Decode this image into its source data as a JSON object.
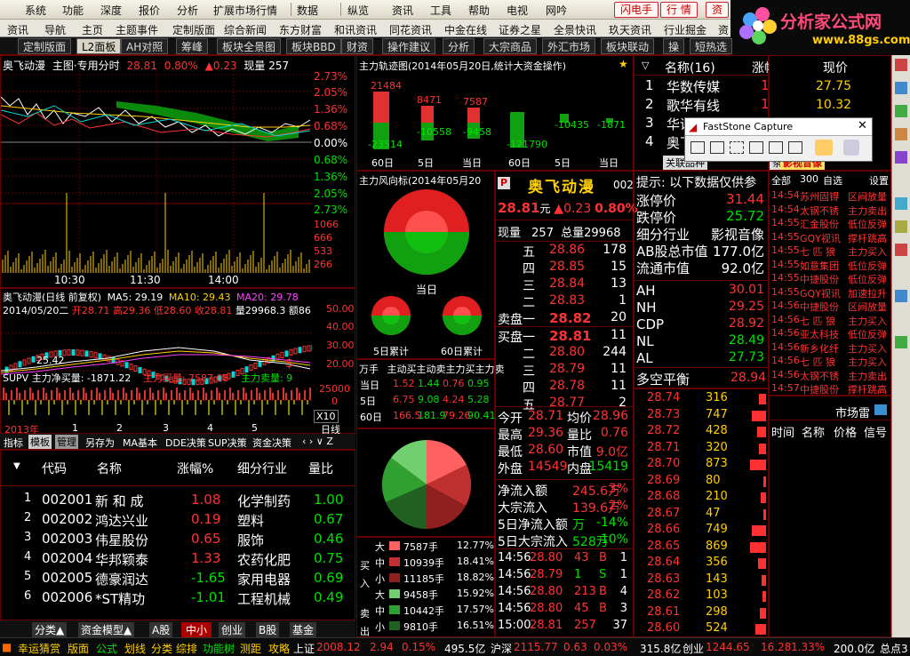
{
  "menu": [
    "系统",
    "功能",
    "深度",
    "报价",
    "分析",
    "扩展市场行情",
    "数据",
    "纵览",
    "资讯",
    "工具",
    "帮助",
    "电视",
    "网吟"
  ],
  "menu_buttons": [
    "闪电手",
    "行 情",
    "资"
  ],
  "logo": {
    "title": "分析家公式网",
    "url": "www.88gs.com"
  },
  "tabs2": [
    "资讯",
    "导航",
    "主页",
    "主题事件",
    "定制版面",
    "综合新闻",
    "东方财富",
    "和讯资讯",
    "同花资讯",
    "中金在线",
    "证券之星",
    "全景快讯",
    "玖天资讯",
    "行业掘金",
    "资"
  ],
  "tabs3": [
    "定制版面",
    "L2面板",
    "AH对照",
    "筹峰",
    "板块全景图",
    "板块BBD",
    "财资",
    "操作建议",
    "分析",
    "大宗商品",
    "外汇市场",
    "板块联动",
    "操",
    "短热选"
  ],
  "intraday": {
    "header_name": "奥飞动漫",
    "header_mode": "主图·专用分时",
    "price": "28.81",
    "pct": "0.80%",
    "chg": "▲0.23",
    "vol_label": "现量 257",
    "right_axis": [
      "2.73%",
      "2.05%",
      "1.36%",
      "0.68%",
      "0.00%",
      "0.68%",
      "1.36%",
      "2.05%",
      "2.73%"
    ],
    "vol_axis": [
      "1066",
      "933",
      "800",
      "666",
      "533",
      "400",
      "266",
      "133"
    ],
    "times": [
      "10:30",
      "11:30",
      "14:00"
    ]
  },
  "kline": {
    "title": "奥飞动漫(日线 前复权)",
    "ma5": "MA5: 29.19",
    "ma10": "MA10: 29.43",
    "ma20": "MA20: 29.78",
    "info_date": "2014/05/20二",
    "info_open": "开28.71",
    "info_high": "高29.36",
    "info_low": "低28.60",
    "info_close": "收28.81",
    "info_vol": "量29968.3",
    "info_amt": "额86",
    "axis": [
      "50.00",
      "40.00",
      "30.00",
      "20.00"
    ],
    "low_mark": "25.42",
    "supv": "SUPV 主力净买量: -1871.22",
    "supv_buy": "主力买量: 7587.08",
    "supv_sell": "主力卖量: 9",
    "supv_axis": [
      "25000",
      "0"
    ],
    "x10": "X10",
    "years": [
      "2013年",
      "1",
      "2",
      "3",
      "4",
      "5"
    ],
    "period": "日线"
  },
  "indicator_tabs": [
    "指标",
    "模板",
    "管理",
    "另存为",
    "MA基本",
    "DDE决策",
    "SUP决策",
    "资金决策"
  ],
  "stock_list": {
    "headers": [
      "代码",
      "名称",
      "涨幅%",
      "细分行业",
      "量比"
    ],
    "rows": [
      {
        "idx": "1",
        "code": "002001",
        "name": "新 和 成",
        "pct": "1.08",
        "ind": "化学制药",
        "ratio": "1.00"
      },
      {
        "idx": "2",
        "code": "002002",
        "name": "鸿达兴业",
        "pct": "0.19",
        "ind": "塑料",
        "ratio": "0.67"
      },
      {
        "idx": "3",
        "code": "002003",
        "name": "伟星股份",
        "pct": "0.65",
        "ind": "服饰",
        "ratio": "0.46"
      },
      {
        "idx": "4",
        "code": "002004",
        "name": "华邦颖泰",
        "pct": "1.33",
        "ind": "农药化肥",
        "ratio": "0.75"
      },
      {
        "idx": "5",
        "code": "002005",
        "name": "德豪润达",
        "pct": "-1.65",
        "ind": "家用电器",
        "ratio": "0.69"
      },
      {
        "idx": "6",
        "code": "002006",
        "name": "*ST精功",
        "pct": "-1.01",
        "ind": "工程机械",
        "ratio": "0.49"
      }
    ]
  },
  "bottom_tabs": [
    "分类▲",
    "资金模型▲",
    "A股",
    "中小",
    "创业",
    "B股",
    "基金"
  ],
  "track": {
    "title": "主力轨迹图(2014年05月20日,统计大资金操作)",
    "top_vals": [
      "21484",
      "8471",
      "7587"
    ],
    "bot_vals": [
      "-23514",
      "-10558",
      "-9458"
    ],
    "top_vals2": [
      "-10435",
      "-1871"
    ],
    "bot_vals2": [
      "-121790"
    ],
    "labels": [
      "60日",
      "5日",
      "当日",
      "60日",
      "5日",
      "当日"
    ]
  },
  "wind": {
    "title": "主力风向标(2014年05月20",
    "today": "当日",
    "d5": "5日累计",
    "d60": "60日累计"
  },
  "flow_table": {
    "headers": [
      "万手",
      "主动买",
      "主动卖",
      "主力买",
      "主力卖"
    ],
    "rows": [
      {
        "label": "当日",
        "v": [
          "1.52",
          "1.44",
          "0.76",
          "0.95"
        ]
      },
      {
        "label": "5日",
        "v": [
          "6.75",
          "9.08",
          "4.24",
          "5.28"
        ]
      },
      {
        "label": "60日",
        "v": [
          "166.5",
          "181.9",
          "79.26",
          "90.41"
        ]
      }
    ]
  },
  "pie_legend": {
    "buy": [
      {
        "l": "大",
        "v": "7587手",
        "p": "12.77%"
      },
      {
        "l": "中",
        "v": "10939手",
        "p": "18.41%"
      },
      {
        "l": "小",
        "v": "11185手",
        "p": "18.82%"
      }
    ],
    "sell": [
      {
        "l": "大",
        "v": "9458手",
        "p": "15.92%"
      },
      {
        "l": "中",
        "v": "10442手",
        "p": "17.57%"
      },
      {
        "l": "小",
        "v": "9810手",
        "p": "16.51%"
      }
    ],
    "buy_side": "买入",
    "sell_side": "卖出"
  },
  "quote": {
    "p_badge": "P",
    "name": "奥飞动漫",
    "code_part": "002",
    "price": "28.81",
    "unit": "元",
    "chg": "▲0.23",
    "pct": "0.80%",
    "cur_label": "现量",
    "cur_vol": "257",
    "total_label": "总量",
    "total_vol": "29968",
    "sells": [
      {
        "l": "五",
        "p": "28.86",
        "v": "178"
      },
      {
        "l": "四",
        "p": "28.85",
        "v": "15"
      },
      {
        "l": "三",
        "p": "28.84",
        "v": "13"
      },
      {
        "l": "二",
        "p": "28.83",
        "v": "1"
      },
      {
        "l": "卖盘一",
        "p": "28.82",
        "v": "20"
      }
    ],
    "buys": [
      {
        "l": "买盘一",
        "p": "28.81",
        "v": "11"
      },
      {
        "l": "二",
        "p": "28.80",
        "v": "244"
      },
      {
        "l": "三",
        "p": "28.79",
        "v": "11"
      },
      {
        "l": "四",
        "p": "28.78",
        "v": "11"
      },
      {
        "l": "五",
        "p": "28.77",
        "v": "2"
      }
    ],
    "stats": [
      {
        "l1": "今开",
        "v1": "28.71",
        "l2": "均价",
        "v2": "28.96"
      },
      {
        "l1": "最高",
        "v1": "29.36",
        "l2": "量比",
        "v2": "0.76"
      },
      {
        "l1": "最低",
        "v1": "28.60",
        "l2": "市值",
        "v2": "9.0亿"
      },
      {
        "l1": "外盘",
        "v1": "14549",
        "l2": "内盘",
        "v2": "15419"
      }
    ],
    "flows": [
      {
        "l": "净流入额",
        "v": "245.6万",
        "p": "3%"
      },
      {
        "l": "大宗流入",
        "v": "139.6万",
        "p": "2%"
      },
      {
        "l": "5日净流入额",
        "v": "万",
        "p": "-14%"
      },
      {
        "l": "5日大宗流入",
        "v": "528万",
        "p": "-10%"
      }
    ],
    "ticks": [
      {
        "t": "14:56",
        "p": "28.80",
        "v": "43",
        "f": "B",
        "n": "1"
      },
      {
        "t": "14:56",
        "p": "28.79",
        "v": "1",
        "f": "S",
        "n": "1"
      },
      {
        "t": "14:56",
        "p": "28.80",
        "v": "213",
        "f": "B",
        "n": "4"
      },
      {
        "t": "14:56",
        "p": "28.80",
        "v": "45",
        "f": "B",
        "n": "3"
      },
      {
        "t": "15:00",
        "p": "28.81",
        "v": "257",
        "f": "",
        "n": "37"
      }
    ]
  },
  "rank": {
    "headers": [
      "名称(16)",
      "涨幅%",
      "现价"
    ],
    "rows": [
      {
        "i": "1",
        "n": "华数传媒",
        "p": "1.83",
        "v": "27.75"
      },
      {
        "i": "2",
        "n": "歌华有线",
        "p": "1.57",
        "v": "10.32"
      },
      {
        "i": "3",
        "n": "华谊兄弟",
        "p": "",
        "v": ""
      },
      {
        "i": "4",
        "n": "奥飞动漫",
        "p": "",
        "v": ""
      }
    ],
    "subtabs": [
      "关联品种",
      "条板块",
      "影视音像"
    ]
  },
  "info": {
    "hint": "提示: 以下数据仅供参",
    "rows": [
      {
        "l": "涨停价",
        "v": "31.44",
        "c": "red"
      },
      {
        "l": "跌停价",
        "v": "25.72",
        "c": "green"
      },
      {
        "l": "细分行业",
        "v": "影视音像",
        "c": "white"
      },
      {
        "l": "AB股总市值",
        "v": "177.0亿",
        "c": "white"
      },
      {
        "l": "流通市值",
        "v": "92.0亿",
        "c": "white"
      }
    ],
    "idx": [
      {
        "l": "AH",
        "v": "30.01",
        "c": "red"
      },
      {
        "l": "NH",
        "v": "29.25",
        "c": "red"
      },
      {
        "l": "CDP",
        "v": "28.92",
        "c": "red"
      },
      {
        "l": "NL",
        "v": "28.49",
        "c": "green"
      },
      {
        "l": "AL",
        "v": "27.73",
        "c": "green"
      }
    ],
    "balance_l": "多空平衡",
    "balance_v": "28.94"
  },
  "price_ladder": [
    {
      "p": "28.74",
      "v": "316"
    },
    {
      "p": "28.73",
      "v": "747"
    },
    {
      "p": "28.72",
      "v": "428"
    },
    {
      "p": "28.71",
      "v": "320"
    },
    {
      "p": "28.70",
      "v": "873"
    },
    {
      "p": "28.69",
      "v": "80"
    },
    {
      "p": "28.68",
      "v": "210"
    },
    {
      "p": "28.67",
      "v": "47"
    },
    {
      "p": "28.66",
      "v": "749"
    },
    {
      "p": "28.65",
      "v": "869"
    },
    {
      "p": "28.64",
      "v": "356"
    },
    {
      "p": "28.63",
      "v": "143"
    },
    {
      "p": "28.62",
      "v": "103"
    },
    {
      "p": "28.61",
      "v": "298"
    },
    {
      "p": "28.60",
      "v": "524"
    }
  ],
  "news": [
    {
      "t": "14:54",
      "n": "苏州固锝",
      "e": "区间放量"
    },
    {
      "t": "14:54",
      "n": "太钢不锈",
      "e": "主力卖出"
    },
    {
      "t": "14:55",
      "n": "汇金股份",
      "e": "低位反弹"
    },
    {
      "t": "14:55",
      "n": "GQY视讯",
      "e": "撑杆跳高"
    },
    {
      "t": "14:55",
      "n": "七 匹 狼",
      "e": "主力买入"
    },
    {
      "t": "14:55",
      "n": "如意集团",
      "e": "低位反弹"
    },
    {
      "t": "14:55",
      "n": "中捷股份",
      "e": "低位反弹"
    },
    {
      "t": "14:55",
      "n": "GQY视讯",
      "e": "加速拉升"
    },
    {
      "t": "14:56",
      "n": "中捷股份",
      "e": "区间放量"
    },
    {
      "t": "14:56",
      "n": "七 匹 狼",
      "e": "主力买入"
    },
    {
      "t": "14:56",
      "n": "亚太科技",
      "e": "低位反弹"
    },
    {
      "t": "14:56",
      "n": "新乡化纤",
      "e": "主力买入"
    },
    {
      "t": "14:56",
      "n": "七 匹 狼",
      "e": "主力买入"
    },
    {
      "t": "14:56",
      "n": "太钢不锈",
      "e": "主力卖出"
    },
    {
      "t": "14:57",
      "n": "中捷股份",
      "e": "撑杆跳高"
    }
  ],
  "news_head": {
    "all": "全部",
    "n300": "300",
    "zixuan": "自选",
    "setting": "设置"
  },
  "radar": {
    "title": "市场雷",
    "cols": [
      "时间",
      "名称",
      "价格",
      "信号"
    ]
  },
  "faststone": {
    "title": "FastStone Capture"
  },
  "status": {
    "items": [
      "幸运猜赏",
      "版面",
      "公式",
      "划线",
      "分类",
      "综排",
      "功能树",
      "测距",
      "攻略"
    ],
    "sh_l": "上证",
    "sh_v": "2008.12",
    "sh_c": "2.94",
    "sh_p": "0.15%",
    "sh_a": "495.5亿",
    "hs_l": "沪深",
    "hs_v": "2115.77",
    "hs_c": "0.63",
    "hs_p": "0.03%",
    "hs_a": "315.8亿",
    "cy_l": "创业",
    "cy_v": "1244.65",
    "cy_c": "16.28",
    "cy_p": "1.33%",
    "cy_a": "200.0亿",
    "tail": "总点3"
  }
}
